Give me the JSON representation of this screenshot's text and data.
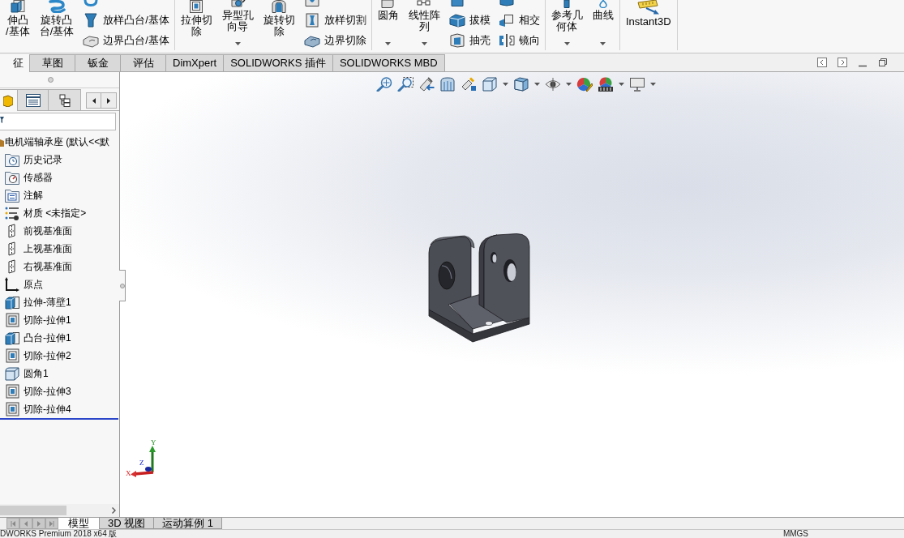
{
  "ribbon": {
    "groups": [
      {
        "items": [
          {
            "kind": "large",
            "label_lines": [
              "伸凸",
              "/基体"
            ],
            "caret": false
          },
          {
            "kind": "large",
            "label_lines": [
              "旋转凸",
              "台/基体"
            ],
            "caret": false
          },
          {
            "kind": "stack",
            "buttons": [
              {
                "label": "放样凸台/基体"
              },
              {
                "label": "边界凸台/基体"
              }
            ]
          }
        ]
      },
      {
        "items": [
          {
            "kind": "large",
            "label_lines": [
              "拉伸切",
              "除"
            ],
            "caret": false
          },
          {
            "kind": "large",
            "label_lines": [
              "异型孔",
              "向导"
            ],
            "caret": true
          },
          {
            "kind": "large",
            "label_lines": [
              "旋转切",
              "除"
            ],
            "caret": false
          },
          {
            "kind": "stack",
            "buttons": [
              {
                "label": "放样切割"
              },
              {
                "label": "边界切除"
              }
            ]
          }
        ]
      },
      {
        "items": [
          {
            "kind": "large",
            "label_lines": [
              "圆角"
            ],
            "caret": true
          },
          {
            "kind": "large",
            "label_lines": [
              "线性阵",
              "列"
            ],
            "caret": true
          },
          {
            "kind": "stack",
            "buttons": [
              {
                "label": "拔模"
              },
              {
                "label": "抽壳"
              }
            ]
          },
          {
            "kind": "stack",
            "buttons": [
              {
                "label": "相交"
              },
              {
                "label": "镜向"
              }
            ]
          }
        ]
      },
      {
        "items": [
          {
            "kind": "large",
            "label_lines": [
              "参考几",
              "何体"
            ],
            "caret": true
          },
          {
            "kind": "large",
            "label_lines": [
              "曲线"
            ],
            "caret": true
          }
        ]
      },
      {
        "items": [
          {
            "kind": "large",
            "label_lines": [
              "Instant3D"
            ],
            "caret": false
          }
        ]
      }
    ]
  },
  "command_tabs": [
    {
      "label": "征",
      "selected": true
    },
    {
      "label": "草图",
      "selected": false
    },
    {
      "label": "钣金",
      "selected": false
    },
    {
      "label": "评估",
      "selected": false
    },
    {
      "label": "DimXpert",
      "selected": false
    },
    {
      "label": "SOLIDWORKS 插件",
      "selected": false
    },
    {
      "label": "SOLIDWORKS MBD",
      "selected": false
    }
  ],
  "sidebar": {
    "panel_tabs": [
      {
        "selected": true
      },
      {
        "selected": false
      },
      {
        "selected": false
      }
    ],
    "tree": [
      {
        "kind": "part",
        "label": "电机端轴承座 (默认<<默",
        "children": [
          {
            "kind": "history",
            "label": "历史记录"
          },
          {
            "kind": "sensor",
            "label": "传感器"
          },
          {
            "kind": "annotation",
            "label": "注解"
          },
          {
            "kind": "material",
            "label": "材质 <未指定>"
          },
          {
            "kind": "plane",
            "label": "前视基准面"
          },
          {
            "kind": "plane",
            "label": "上视基准面"
          },
          {
            "kind": "plane",
            "label": "右视基准面"
          },
          {
            "kind": "origin",
            "label": "原点"
          },
          {
            "kind": "boss",
            "label": "拉伸-薄壁1"
          },
          {
            "kind": "cut",
            "label": "切除-拉伸1"
          },
          {
            "kind": "boss",
            "label": "凸台-拉伸1"
          },
          {
            "kind": "cut",
            "label": "切除-拉伸2"
          },
          {
            "kind": "fillet",
            "label": "圆角1"
          },
          {
            "kind": "cut",
            "label": "切除-拉伸3"
          },
          {
            "kind": "cut",
            "label": "切除-拉伸4"
          }
        ]
      }
    ]
  },
  "view_toolbar": [
    {
      "caret": false
    },
    {
      "caret": false
    },
    {
      "caret": false
    },
    {
      "caret": false
    },
    {
      "caret": false
    },
    {
      "caret": true
    },
    {
      "caret": true
    },
    {
      "caret": true
    },
    {
      "caret": false
    },
    {
      "caret": true
    },
    {
      "caret": true
    }
  ],
  "viewport": {
    "triad": {
      "labels": [
        "Y",
        "Z",
        "X"
      ]
    }
  },
  "model_tabs": [
    {
      "label": "模型",
      "selected": true
    },
    {
      "label": "3D 视图",
      "selected": false
    },
    {
      "label": "运动算例 1",
      "selected": false
    }
  ],
  "status_bar": {
    "product": "DWORKS Premium 2018 x64 版",
    "units": "MMGS"
  }
}
